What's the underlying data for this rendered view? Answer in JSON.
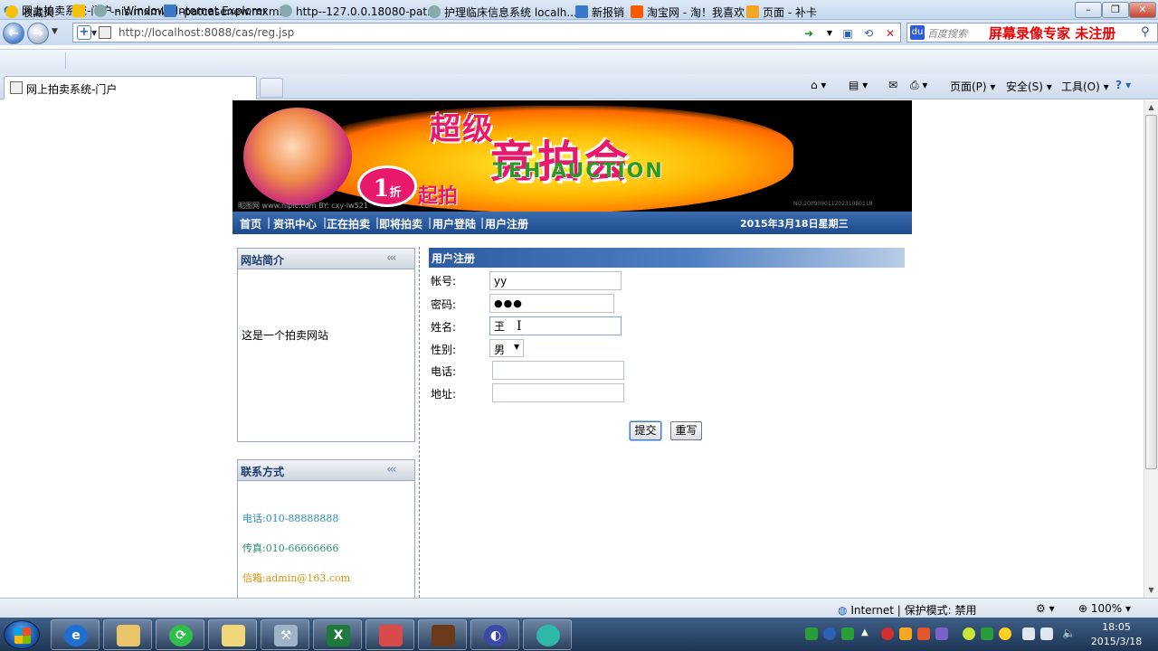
{
  "window": {
    "title": "网上拍卖系统-门户 - Windows Internet Explorer"
  },
  "address": {
    "url": "http://localhost:8088/cas/reg.jsp",
    "search_placeholder": "百度搜索"
  },
  "watermark": "屏幕录像专家 未注册",
  "favorites": {
    "label": "收藏夹",
    "items": [
      "-nis.mxml",
      "-patcasenew.mxml",
      "http--127.0.0.18080-pat...",
      "护理临床信息系统 localh...",
      "新报销",
      "淘宝网 - 淘！我喜欢",
      "页面 - 补卡"
    ]
  },
  "tab": {
    "title": "网上拍卖系统-门户"
  },
  "commandbar": {
    "page": "页面(P)",
    "safety": "安全(S)",
    "tools": "工具(O)"
  },
  "banner": {
    "title_top": "超级",
    "title_main": "竞拍会",
    "title_en": "TEH AUCTION",
    "discount_num": "1",
    "discount_unit": "折",
    "discount_text": "起拍",
    "credit": "昵图网 www.nipic.com   BY: cxy-lw521",
    "serial": "NO:20090901120231080118"
  },
  "nav": {
    "links": [
      "首页",
      "资讯中心",
      "正在拍卖",
      "即将拍卖",
      "用户登陆",
      "用户注册"
    ],
    "date": "2015年3月18日星期三"
  },
  "sidebar": {
    "intro_title": "网站简介",
    "intro_text": "这是一个拍卖网站",
    "contact_title": "联系方式",
    "phone": "电话:010-88888888",
    "fax": "传真:010-66666666",
    "email": "信箱:admin@163.com"
  },
  "register": {
    "title": "用户注册",
    "account_label": "帐号:",
    "account_value": "yy",
    "password_label": "密码:",
    "password_value": "●●●",
    "name_label": "姓名:",
    "name_value": "玊",
    "gender_label": "性别:",
    "gender_value": "男",
    "phone_label": "电话:",
    "phone_value": "",
    "address_label": "地址:",
    "address_value": "",
    "submit": "提交",
    "reset": "重写"
  },
  "status": {
    "zone": "Internet | 保护模式: 禁用",
    "zoom": "100%"
  },
  "taskbar": {
    "time": "18:05",
    "date": "2015/3/18"
  }
}
